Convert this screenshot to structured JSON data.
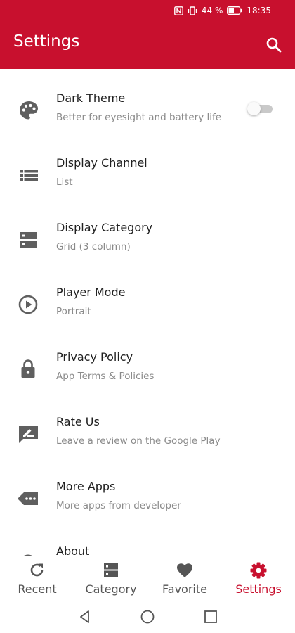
{
  "status_bar": {
    "battery": "44 %",
    "time": "18:35"
  },
  "app_bar": {
    "title": "Settings",
    "search_icon": "search-icon"
  },
  "colors": {
    "primary": "#c8102e",
    "icon": "#5f5f5f",
    "subtitle": "#8a8a8a"
  },
  "settings_items": [
    {
      "label": "Dark Theme",
      "subtitle": "Better for eyesight and battery life",
      "icon": "palette-icon",
      "toggle_on": false
    },
    {
      "label": "Display Channel",
      "subtitle": "List",
      "icon": "view-list-icon"
    },
    {
      "label": "Display Category",
      "subtitle": "Grid (3 column)",
      "icon": "view-grid-icon"
    },
    {
      "label": "Player Mode",
      "subtitle": "Portrait",
      "icon": "play-circle-icon"
    },
    {
      "label": "Privacy Policy",
      "subtitle": "App Terms & Policies",
      "icon": "lock-icon"
    },
    {
      "label": "Rate Us",
      "subtitle": "Leave a review on the Google Play",
      "icon": "rate-review-icon"
    },
    {
      "label": "More Apps",
      "subtitle": "More apps from developer",
      "icon": "more-apps-icon"
    },
    {
      "label": "About",
      "subtitle": "",
      "icon": "info-icon"
    }
  ],
  "bottom_nav": [
    {
      "label": "Recent",
      "icon": "refresh-icon",
      "active": false
    },
    {
      "label": "Category",
      "icon": "category-icon",
      "active": false
    },
    {
      "label": "Favorite",
      "icon": "heart-icon",
      "active": false
    },
    {
      "label": "Settings",
      "icon": "gear-icon",
      "active": true
    }
  ],
  "system_nav": {
    "back": "back-icon",
    "home": "home-icon",
    "recents": "recents-icon"
  }
}
